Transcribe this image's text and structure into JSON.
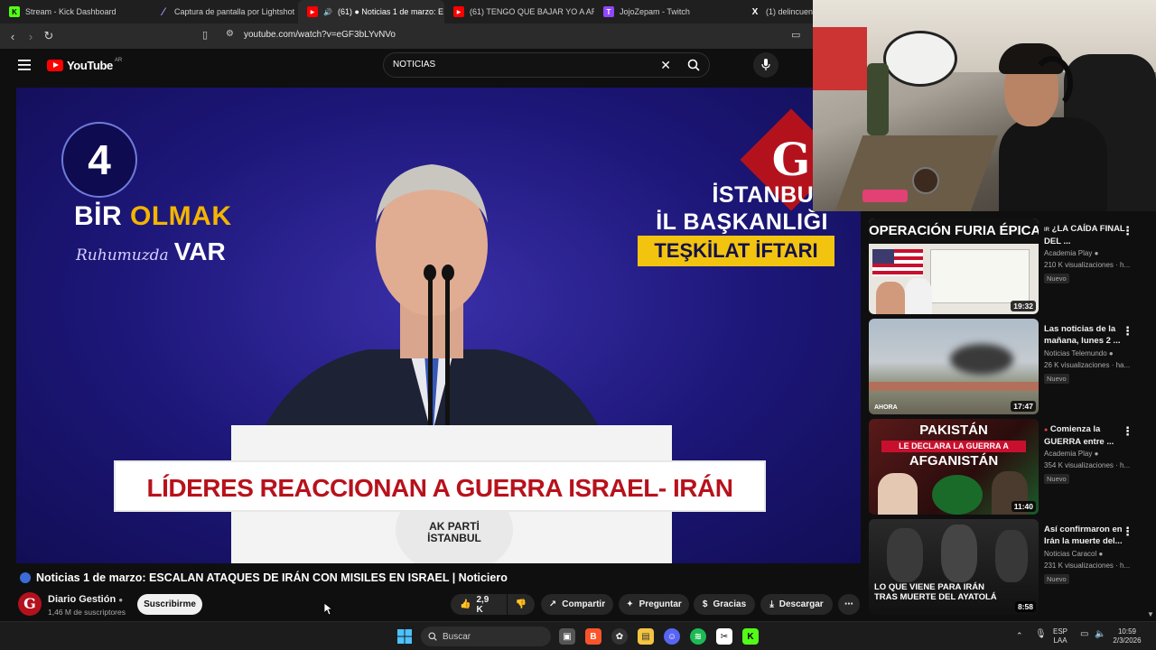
{
  "browser": {
    "tabs": [
      {
        "label": "Stream - Kick Dashboard",
        "color": "#53fc18",
        "glyph": "K"
      },
      {
        "label": "Captura de pantalla por Lightshot",
        "color": "#a58bff",
        "glyph": "/"
      },
      {
        "label": "(61) ● Noticias 1 de marzo: E",
        "color": "#ff0000",
        "glyph": "▶",
        "active": true
      },
      {
        "label": "(61) TENGO QUE BAJAR YO A ARREG",
        "color": "#ff0000",
        "glyph": "▶"
      },
      {
        "label": "JojoZepam - Twitch",
        "color": "#9146ff",
        "glyph": "T"
      },
      {
        "label": "(1) delincuente",
        "color": "#ffffff",
        "glyph": "X"
      }
    ],
    "url": "youtube.com/watch?v=eGF3bLYvNVo"
  },
  "youtube": {
    "logo_text": "YouTube",
    "region": "AR",
    "search_query": "NOTICIAS"
  },
  "video": {
    "overlay_number": "4",
    "bir": "BİR",
    "olmak": "OLMAK",
    "ruh": "Ruhumuzda",
    "var": "VAR",
    "logo_letter": "G",
    "istanbul_line1": "İSTANBUL",
    "istanbul_line2": "İL BAŞKANLIĞI",
    "iftari": "TEŞKİLAT İFTARI",
    "lower_third": "LÍDERES REACCIONAN A GUERRA ISRAEL- IRÁN",
    "podium_label_1": "AK PARTİ",
    "podium_label_2": "İSTANBUL",
    "title": "Noticias 1 de marzo: ESCALAN ATAQUES DE IRÁN CON MISILES EN ISRAEL | Noticiero"
  },
  "channel": {
    "avatar_letter": "G",
    "name": "Diario Gestión",
    "subscribers": "1,46 M de suscriptores",
    "subscribe_label": "Suscribirme"
  },
  "actions": {
    "likes": "2,9 K",
    "share": "Compartir",
    "ask": "Preguntar",
    "thanks": "Gracias",
    "download": "Descargar"
  },
  "recommendations": [
    {
      "title": "¿LA CAÍDA FINAL DEL ...",
      "prefix": "IR",
      "channel": "Academia Play",
      "meta": "210 K visualizaciones · h...",
      "duration": "19:32",
      "badge": "Nuevo",
      "thumb_caption": "OPERACIÓN FURIA ÉPICA"
    },
    {
      "title": "Las noticias de la mañana, lunes 2 ...",
      "prefix": "",
      "channel": "Noticias Telemundo",
      "meta": "26 K visualizaciones · ha...",
      "duration": "17:47",
      "badge": "Nuevo",
      "thumb_caption": "AHORA"
    },
    {
      "title": "Comienza la GUERRA entre ...",
      "prefix": "●",
      "channel": "Academia Play",
      "meta": "354 K visualizaciones · h...",
      "duration": "11:40",
      "badge": "Nuevo",
      "thumb_caption": "PAKISTÁN",
      "thumb_caption2": "LE DECLARA LA GUERRA A",
      "thumb_caption3": "AFGANISTÁN"
    },
    {
      "title": "Así confirmaron en Irán la muerte del...",
      "prefix": "",
      "channel": "Noticias Caracol",
      "meta": "231 K visualizaciones · h...",
      "duration": "8:58",
      "badge": "Nuevo",
      "thumb_caption": "LO QUE VIENE PARA IRÁN",
      "thumb_caption2": "TRAS MUERTE DEL AYATOLÁ"
    }
  ],
  "taskbar": {
    "search_label": "Buscar",
    "lang_1": "ESP",
    "lang_2": "LAA",
    "time": "10:59",
    "date": "2/3/2026"
  }
}
